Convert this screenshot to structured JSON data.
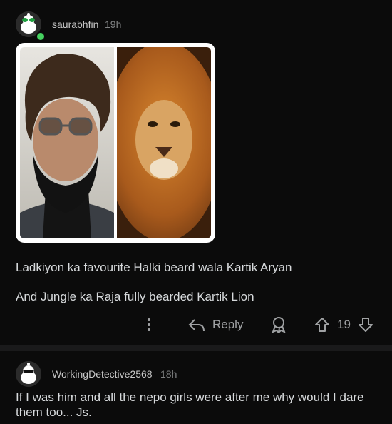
{
  "comment1": {
    "username": "saurabhfin",
    "time": "19h",
    "paragraph1": "Ladkiyon ka favourite Halki beard wala Kartik Aryan",
    "paragraph2": "And Jungle ka Raja fully bearded Kartik Lion",
    "actions": {
      "reply_label": "Reply",
      "vote_count": "19"
    }
  },
  "comment2": {
    "username": "WorkingDetective2568",
    "time": "18h",
    "text": "If I was him and all the nepo girls were after me why would I dare them too... Js."
  },
  "colors": {
    "background": "#000000",
    "card": "#0b0b0b",
    "separator": "#1a1a1b",
    "online": "#46d160",
    "text": "#d7dadc",
    "meta": "#818384"
  },
  "icons": [
    "avatar",
    "online-status",
    "more-options-icon",
    "reply-icon",
    "award-icon",
    "upvote-icon",
    "downvote-icon"
  ]
}
